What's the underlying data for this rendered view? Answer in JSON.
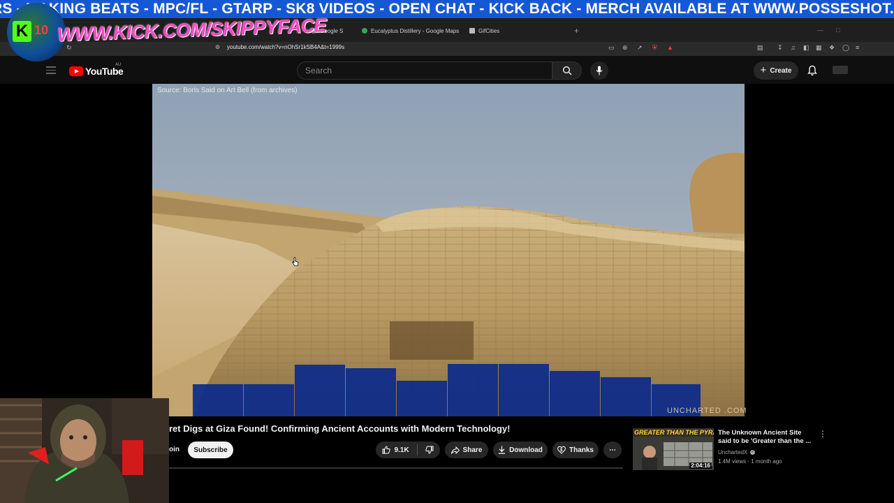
{
  "ticker": {
    "text": "RS - MAKING BEATS - MPC/FL - GTARP - SK8 VIDEOS - OPEN CHAT - KICK BACK  - MERCH AVAILABLE AT WWW.POSSESHOT.CO"
  },
  "overlay": {
    "kick_badge_letter": "K",
    "kick_badge_level": "10",
    "kick_url": "WWW.KICK.COM/SKIPPYFACE"
  },
  "browser": {
    "tabs": [
      {
        "label": "Google S",
        "favicon_color": "#888888"
      },
      {
        "label": "Eucalyptus Distillery - Google Maps",
        "favicon_color": "#34a853"
      },
      {
        "label": "GifCities",
        "favicon_color": "#bbbbbb"
      }
    ],
    "new_tab": "+",
    "url": "youtube.com/watch?v=nOhSr1kSB4A&t=1999s"
  },
  "youtube": {
    "logo_text": "YouTube",
    "region": "AU",
    "search_placeholder": "Search",
    "create_label": "Create"
  },
  "video": {
    "source_caption": "Source: Boris Said on Art Bell (from archives)",
    "watermark": "UNCHARTED .COM",
    "title": "ret Digs at Giza Found! Confirming Ancient Accounts with Modern Technology!",
    "join_label": "oin",
    "subscribe_label": "Subscribe",
    "likes": "9.1K",
    "share_label": "Share",
    "download_label": "Download",
    "thanks_label": "Thanks",
    "more_label": "⋯"
  },
  "recommended": {
    "thumb_text": "GREATER THAN THE PYRAMIDS?",
    "duration": "2:04:16",
    "title": "The Unknown Ancient Site said to be 'Greater than the ...",
    "channel": "UnchartedX",
    "meta": "1.4M views · 1 month ago"
  },
  "colors": {
    "ticker_bg": "#1558d6",
    "kick_green": "#53fc18",
    "yt_red": "#ff0000",
    "kick_url_pink": "#ff48c8"
  }
}
